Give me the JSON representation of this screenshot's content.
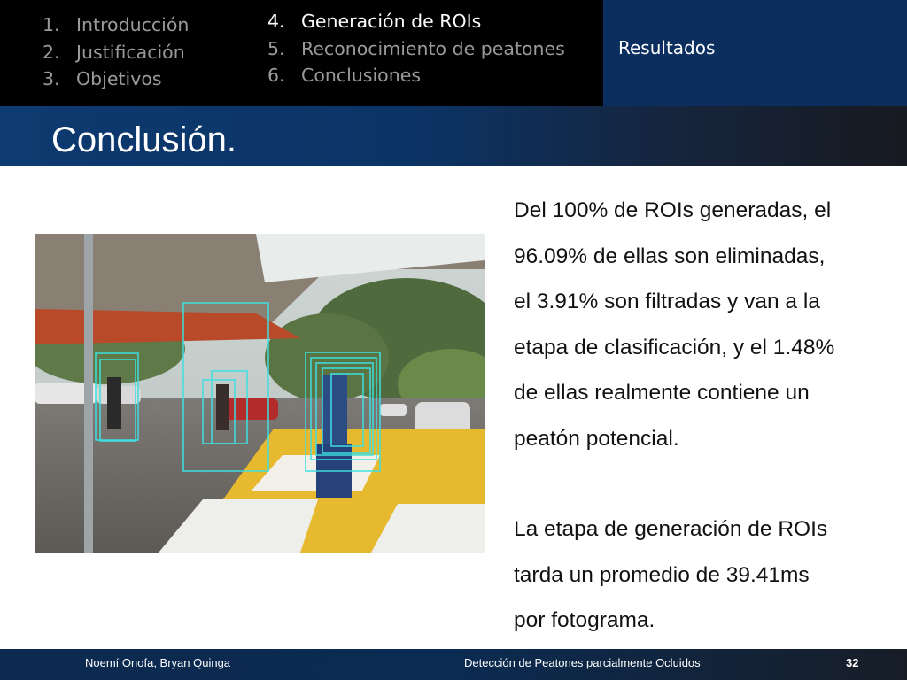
{
  "nav": {
    "col1": [
      {
        "num": "1.",
        "label": "Introducción"
      },
      {
        "num": "2.",
        "label": "Justificación"
      },
      {
        "num": "3.",
        "label": "Objetivos"
      }
    ],
    "col2": [
      {
        "num": "4.",
        "label": "Generación de ROIs"
      },
      {
        "num": "5.",
        "label": "Reconocimiento de peatones"
      },
      {
        "num": "6.",
        "label": "Conclusiones"
      }
    ],
    "results": "Resultados"
  },
  "slide": {
    "title": "Conclusión.",
    "paragraph1": [
      "Del 100% de ROIs generadas, el",
      "96.09% de ellas son eliminadas,",
      "el 3.91% son filtradas y van a la",
      "etapa de clasificación, y el 1.48%",
      "de ellas realmente contiene un",
      "peatón potencial."
    ],
    "paragraph2": [
      "La etapa de generación de ROIs",
      "tarda un promedio de 39.41ms",
      "por fotograma."
    ]
  },
  "footer": {
    "authors": "Noemí Onofa, Bryan Quinga",
    "title": "Detección de Peatones parcialmente Ocluidos",
    "page": "32"
  },
  "colors": {
    "nav_bg": "#000000",
    "results_bg": "#0b2e5e",
    "title_band": "#0b3466",
    "roi_box": "#3ee0e0"
  }
}
